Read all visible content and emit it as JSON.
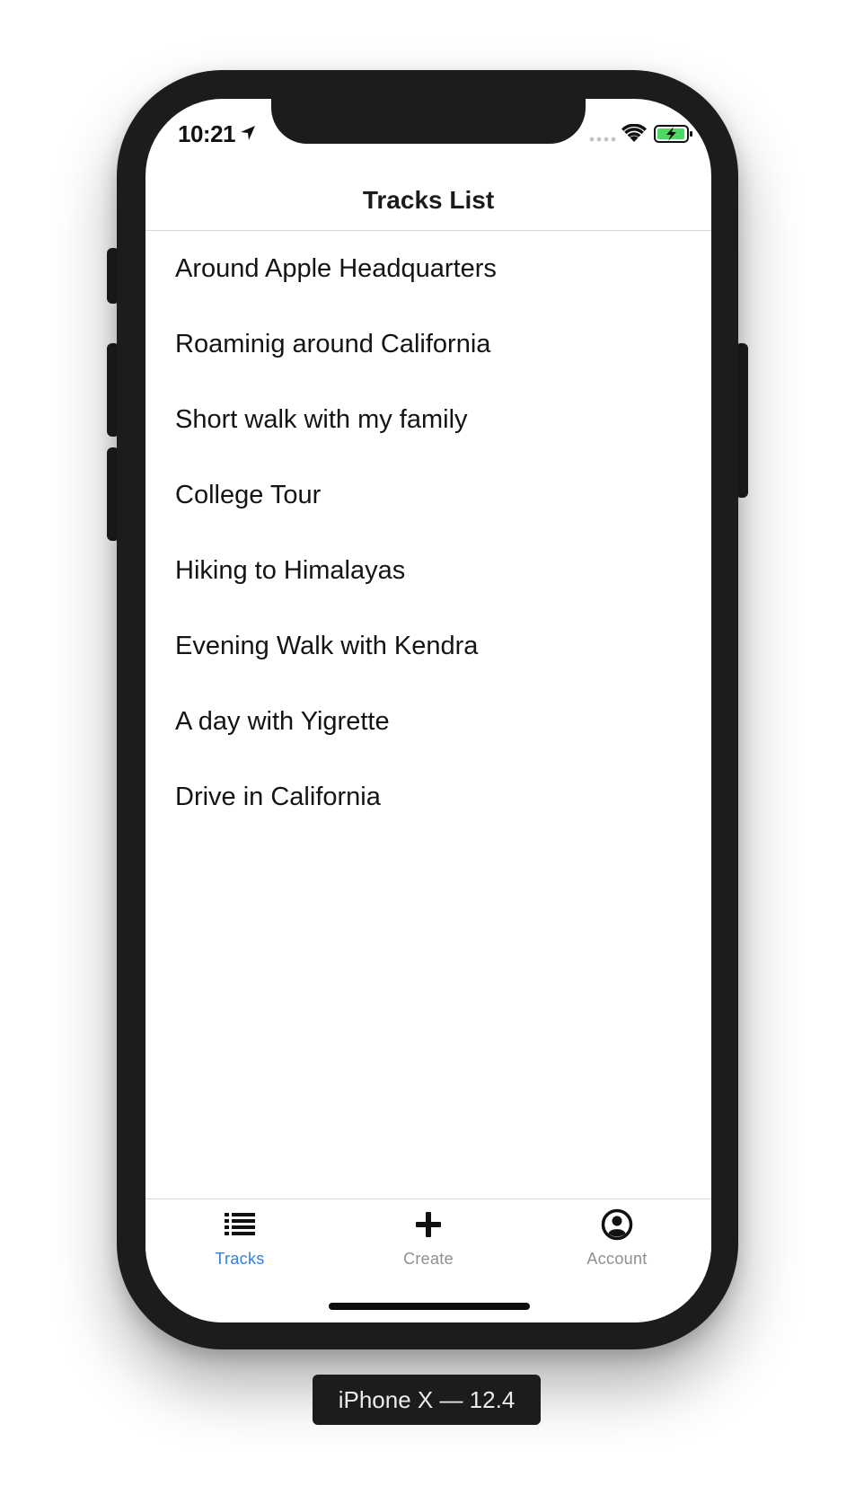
{
  "status_bar": {
    "time": "10:21"
  },
  "header": {
    "title": "Tracks List"
  },
  "tracks": [
    {
      "name": "Around Apple Headquarters"
    },
    {
      "name": "Roaminig around California"
    },
    {
      "name": "Short walk with my family"
    },
    {
      "name": "College Tour"
    },
    {
      "name": "Hiking to Himalayas"
    },
    {
      "name": "Evening Walk with Kendra"
    },
    {
      "name": "A day with Yigrette"
    },
    {
      "name": "Drive in California"
    }
  ],
  "tab_bar": {
    "tabs": [
      {
        "label": "Tracks",
        "icon": "list-icon",
        "active": true
      },
      {
        "label": "Create",
        "icon": "plus-icon",
        "active": false
      },
      {
        "label": "Account",
        "icon": "user-circle-icon",
        "active": false
      }
    ]
  },
  "device_label": "iPhone X — 12.4",
  "colors": {
    "active_tab": "#2f7fe0",
    "inactive_tab": "#8e8e8e",
    "icon": "#111111",
    "battery_fill": "#4cd964",
    "frame": "#1c1c1c"
  }
}
